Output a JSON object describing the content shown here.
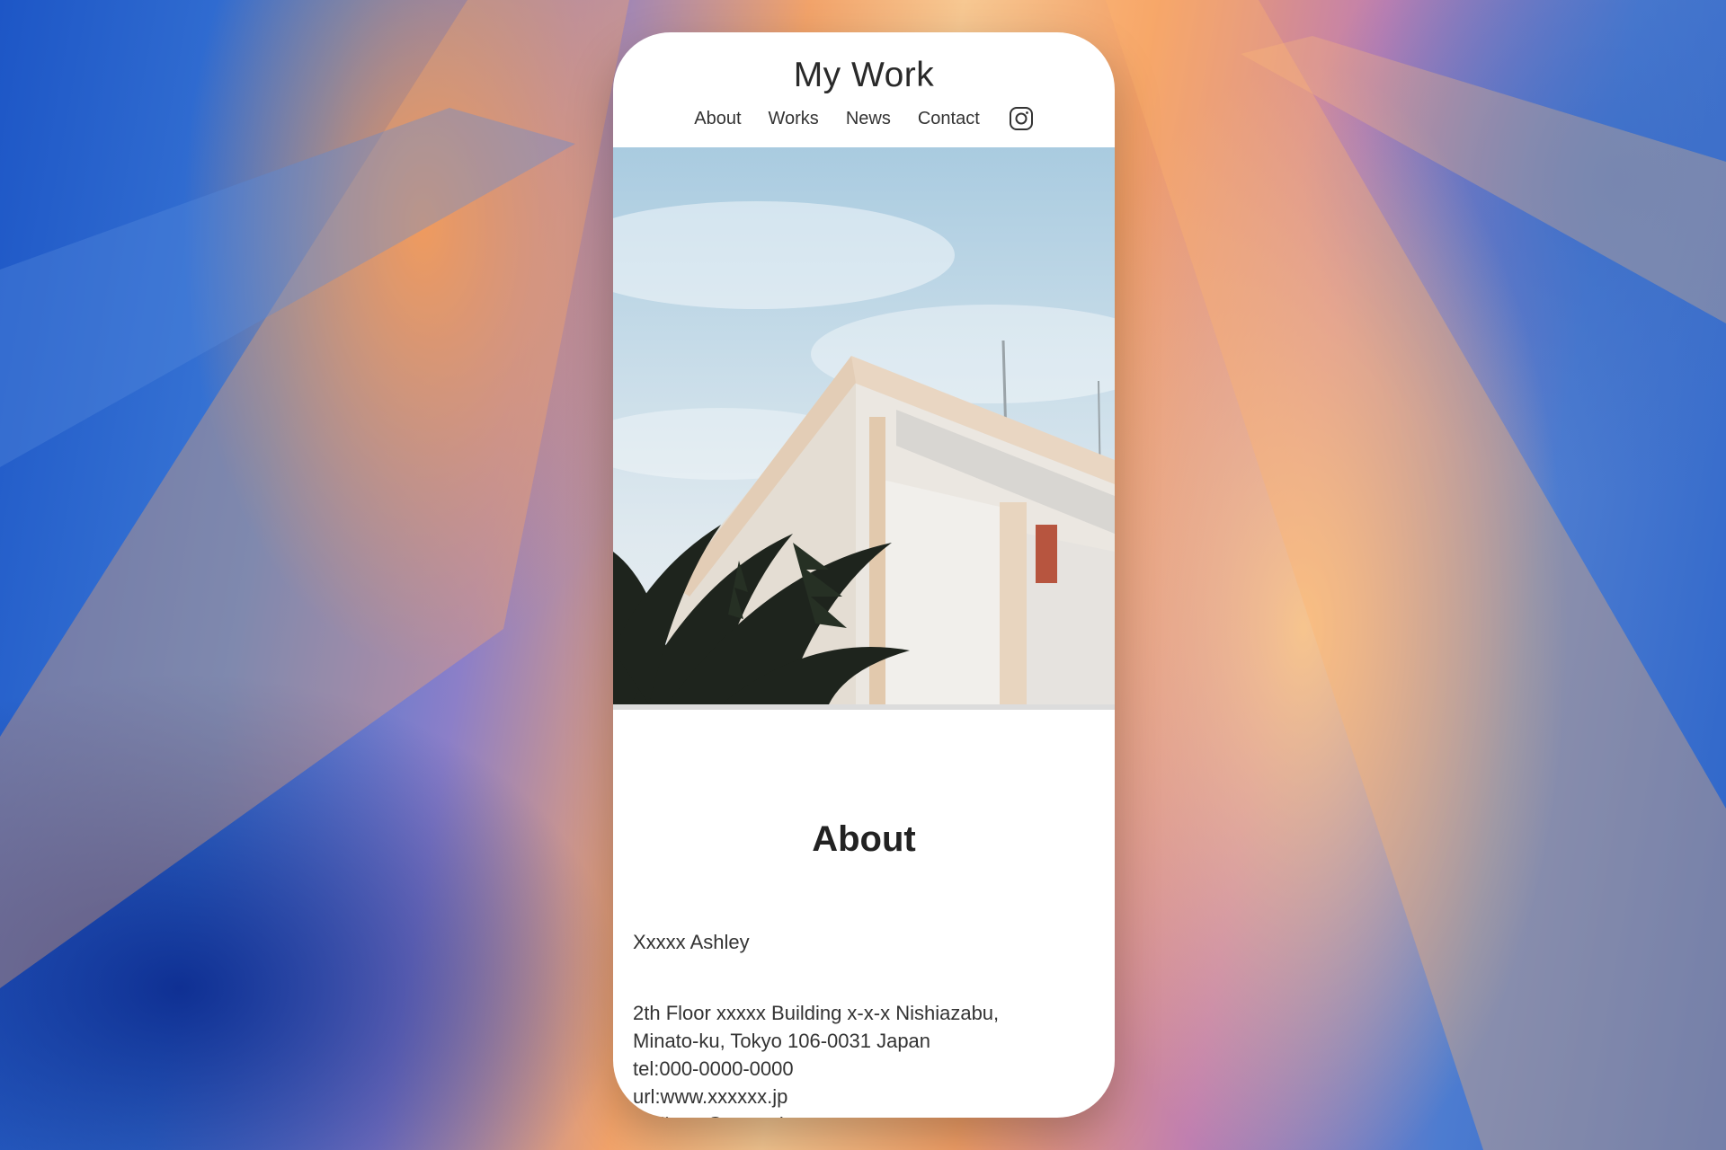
{
  "site": {
    "title": "My Work",
    "nav": [
      "About",
      "Works",
      "News",
      "Contact"
    ]
  },
  "hero": {
    "image": "building-with-palm-photo"
  },
  "about": {
    "heading": "About",
    "name": "Xxxxx Ashley",
    "address_lines": [
      "2th Floor xxxxx Building x-x-x Nishiazabu,",
      "Minato-ku, Tokyo 106-0031 Japan",
      "tel:000-0000-0000",
      "url:www.xxxxxx.jp",
      "mail:xxx@xxxxx.jp"
    ]
  },
  "icons": {
    "social": "instagram-icon"
  },
  "colors": {
    "page_bg": "#ffffff",
    "text": "#333333",
    "sky": "#a9cbe0"
  }
}
